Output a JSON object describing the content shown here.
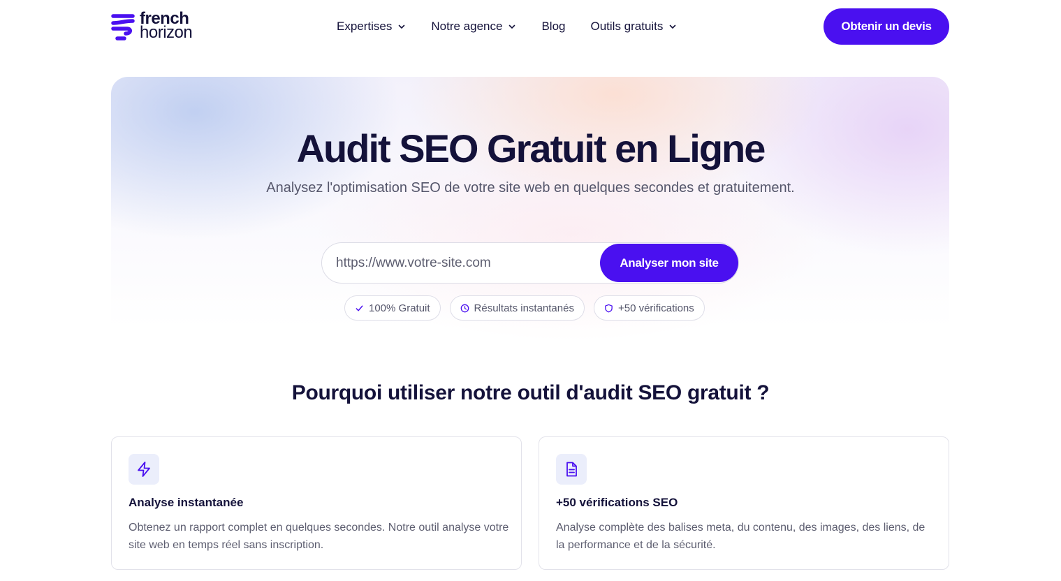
{
  "header": {
    "logo": {
      "line1": "french",
      "line2": "horizon",
      "icon": "french-horizon-logo"
    },
    "nav": [
      {
        "label": "Expertises",
        "has_dropdown": true
      },
      {
        "label": "Notre agence",
        "has_dropdown": true
      },
      {
        "label": "Blog",
        "has_dropdown": false
      },
      {
        "label": "Outils gratuits",
        "has_dropdown": true
      }
    ],
    "cta_label": "Obtenir un devis"
  },
  "hero": {
    "title": "Audit SEO Gratuit en Ligne",
    "subtitle": "Analysez l'optimisation SEO de votre site web en quelques secondes et gratuitement.",
    "search": {
      "placeholder": "https://www.votre-site.com",
      "value": "",
      "button_label": "Analyser mon site"
    },
    "badges": [
      {
        "icon": "check-icon",
        "label": "100% Gratuit"
      },
      {
        "icon": "clock-icon",
        "label": "Résultats instantanés"
      },
      {
        "icon": "shield-icon",
        "label": "+50 vérifications"
      }
    ]
  },
  "features": {
    "title": "Pourquoi utiliser notre outil d'audit SEO gratuit ?",
    "cards": [
      {
        "icon": "lightning-icon",
        "title": "Analyse instantanée",
        "text": "Obtenez un rapport complet en quelques secondes. Notre outil analyse votre site web en temps réel sans inscription."
      },
      {
        "icon": "document-icon",
        "title": "+50 vérifications SEO",
        "text": "Analyse complète des balises meta, du contenu, des images, des liens, de la performance et de la sécurité."
      }
    ]
  },
  "colors": {
    "brand": "#4a10f0",
    "text_dark": "#14123a",
    "text_muted": "#55566b"
  }
}
